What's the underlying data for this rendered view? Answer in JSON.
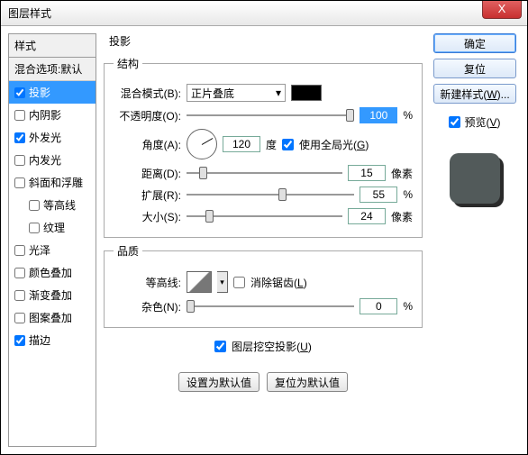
{
  "title": "图层样式",
  "close_x": "X",
  "sidebar": {
    "header": "样式",
    "blend": "混合选项:默认",
    "items": [
      {
        "label": "投影",
        "checked": true,
        "selected": true
      },
      {
        "label": "内阴影",
        "checked": false
      },
      {
        "label": "外发光",
        "checked": true
      },
      {
        "label": "内发光",
        "checked": false
      },
      {
        "label": "斜面和浮雕",
        "checked": false
      },
      {
        "label": "等高线",
        "checked": false,
        "indent": true
      },
      {
        "label": "纹理",
        "checked": false,
        "indent": true
      },
      {
        "label": "光泽",
        "checked": false
      },
      {
        "label": "颜色叠加",
        "checked": false
      },
      {
        "label": "渐变叠加",
        "checked": false
      },
      {
        "label": "图案叠加",
        "checked": false
      },
      {
        "label": "描边",
        "checked": true
      }
    ]
  },
  "main": {
    "heading": "投影",
    "structure": {
      "legend": "结构",
      "blend_mode_label": "混合模式(B):",
      "blend_mode_value": "正片叠底",
      "opacity_label": "不透明度(O):",
      "opacity_value": "100",
      "opacity_unit": "%",
      "angle_label": "角度(A):",
      "angle_value": "120",
      "angle_unit": "度",
      "global_light_label": "使用全局光(G)",
      "distance_label": "距离(D):",
      "distance_value": "15",
      "distance_unit": "像素",
      "spread_label": "扩展(R):",
      "spread_value": "55",
      "spread_unit": "%",
      "size_label": "大小(S):",
      "size_value": "24",
      "size_unit": "像素"
    },
    "quality": {
      "legend": "品质",
      "contour_label": "等高线:",
      "antialias_label": "消除锯齿(L)",
      "noise_label": "杂色(N):",
      "noise_value": "0",
      "noise_unit": "%"
    },
    "knockout_label": "图层挖空投影(U)",
    "set_default": "设置为默认值",
    "reset_default": "复位为默认值"
  },
  "right": {
    "ok": "确定",
    "cancel": "复位",
    "new_style": "新建样式(W)...",
    "preview_label": "预览(V)"
  }
}
